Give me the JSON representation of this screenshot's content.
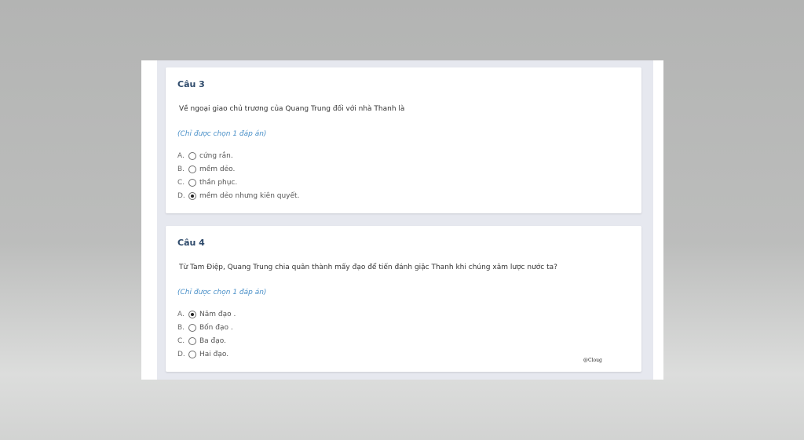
{
  "questions": [
    {
      "title": "Câu 3",
      "text": "Về ngoại giao chủ trương của Quang Trung đối với nhà Thanh là",
      "hint": "(Chỉ được chọn 1 đáp án)",
      "options": [
        {
          "letter": "A.",
          "label": "cứng rắn.",
          "selected": false
        },
        {
          "letter": "B.",
          "label": "mềm dẻo.",
          "selected": false
        },
        {
          "letter": "C.",
          "label": "thần phục.",
          "selected": false
        },
        {
          "letter": "D.",
          "label": "mềm dẻo nhưng kiên quyết.",
          "selected": true
        }
      ]
    },
    {
      "title": "Câu 4",
      "text": "Từ Tam Điệp, Quang Trung chia quân thành mấy đạo để tiến đánh giặc Thanh khi chúng xâm lược nước ta?",
      "hint": "(Chỉ được chọn 1 đáp án)",
      "options": [
        {
          "letter": "A.",
          "label": "Năm đạo .",
          "selected": true
        },
        {
          "letter": "B.",
          "label": "Bốn đạo .",
          "selected": false
        },
        {
          "letter": "C.",
          "label": "Ba đạo.",
          "selected": false
        },
        {
          "letter": "D.",
          "label": "Hai đạo.",
          "selected": false
        }
      ]
    }
  ],
  "watermark": "@Cloug"
}
